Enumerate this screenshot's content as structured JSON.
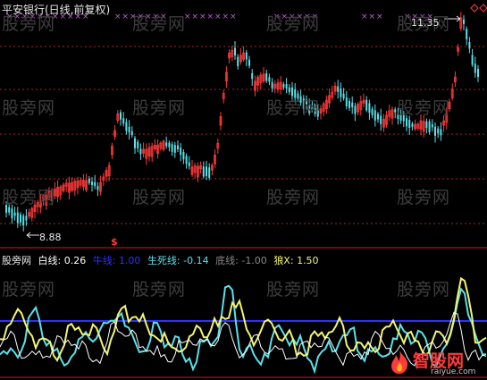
{
  "chart_title": "平安银行(日线,前复权)",
  "price_panel": {
    "high_label": "11.35",
    "low_label": "8.88",
    "signal_label": "$",
    "colors": {
      "up": "#ff3a3a",
      "down": "#5ce0ea",
      "grid": "#b02020",
      "marker": "#c060d0",
      "text": "#e8e8e8"
    }
  },
  "indicator": {
    "name": "股旁网",
    "items": [
      {
        "label": "白线:",
        "value": "0.26",
        "color": "#ffffff"
      },
      {
        "label": "牛线:",
        "value": "1.00",
        "color": "#2f2fff"
      },
      {
        "label": "生死线:",
        "value": "-0.14",
        "color": "#5ce0ea"
      },
      {
        "label": "底线:",
        "value": "-1.00",
        "color": "#888888"
      },
      {
        "label": "狼X:",
        "value": "1.50",
        "color": "#f4f470"
      }
    ],
    "threshold_color": "#2f2fff"
  },
  "watermark_text": "股旁网",
  "logo": {
    "name": "智股网",
    "url": "raiyue.com"
  }
}
